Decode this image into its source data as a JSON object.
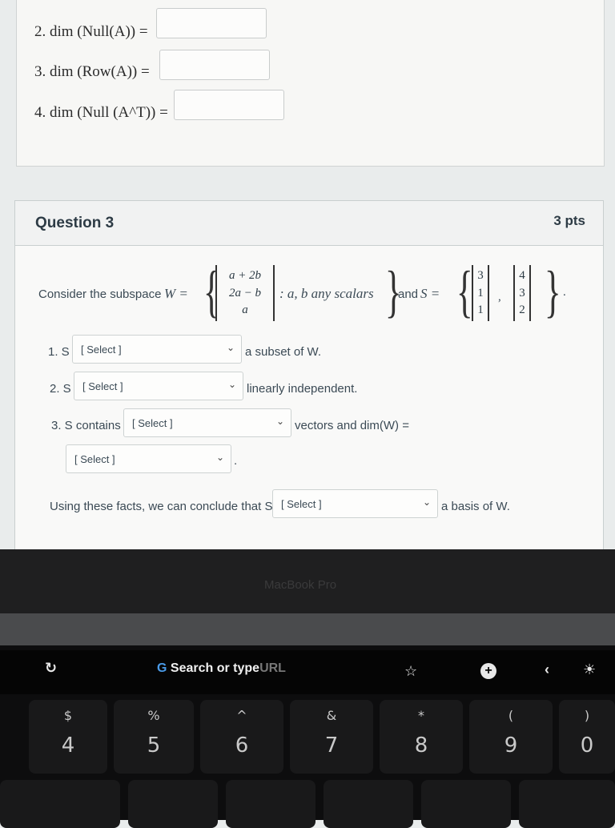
{
  "previous_question": {
    "rows": [
      {
        "label": "2. dim (Null(A)) ="
      },
      {
        "label": "3. dim (Row(A)) ="
      },
      {
        "label": "4. dim (Null (A^T)) ="
      }
    ]
  },
  "question": {
    "title": "Question 3",
    "points": "3 pts",
    "statement": {
      "prefix": "Consider the subspace",
      "w_symbol": "W =",
      "w_matrix": [
        "a + 2b",
        "2a − b",
        "a"
      ],
      "w_condition": ": a, b any scalars",
      "and": "and",
      "s_symbol": "S =",
      "s_vectors": [
        [
          "3",
          "1",
          "1"
        ],
        [
          "4",
          "3",
          "2"
        ]
      ],
      "comma": ",",
      "period": "."
    },
    "items": [
      {
        "prefix": "1. S",
        "select_value": "[ Select ]",
        "suffix": "a subset of W."
      },
      {
        "prefix": "2. S",
        "select_value": "[ Select ]",
        "suffix": "linearly independent."
      },
      {
        "prefix": "3. S contains",
        "select_value": "[ Select ]",
        "suffix": "vectors and dim(W) ="
      },
      {
        "prefix": "",
        "select_value": "[ Select ]",
        "suffix": "."
      }
    ],
    "conclusion": {
      "prefix": "Using these facts, we can conclude that S",
      "select_value": "[ Select ]",
      "suffix": "a basis of W."
    }
  },
  "laptop": {
    "brand_text": "MacBook Pro",
    "touchbar": {
      "search_text": "Search or type",
      "search_faded": "URL"
    },
    "keys": [
      {
        "top": "$",
        "bottom": "4"
      },
      {
        "top": "%",
        "bottom": "5"
      },
      {
        "top": "^",
        "bottom": "6"
      },
      {
        "top": "&",
        "bottom": "7"
      },
      {
        "top": "*",
        "bottom": "8"
      },
      {
        "top": "(",
        "bottom": "9"
      },
      {
        "top": ")",
        "bottom": "0"
      }
    ]
  }
}
